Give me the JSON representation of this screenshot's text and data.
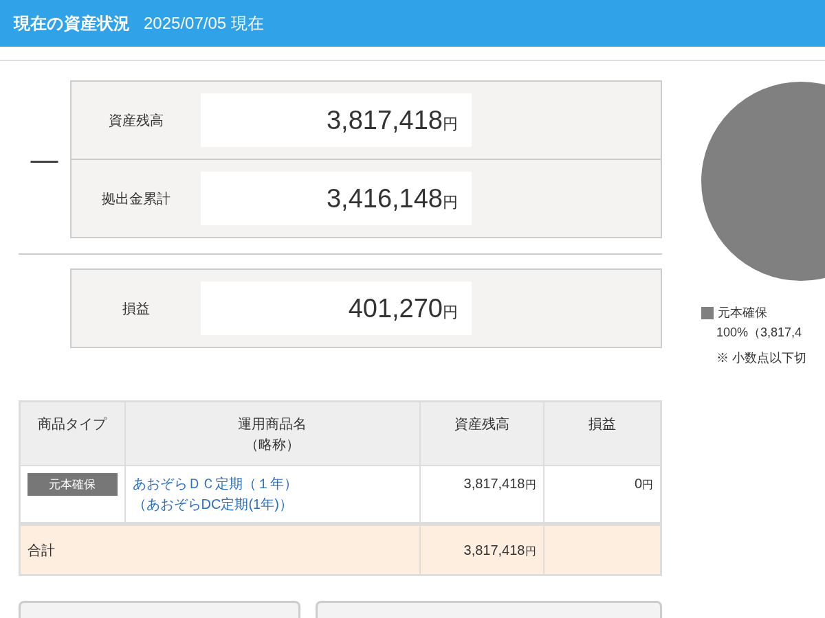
{
  "header": {
    "title": "現在の資産状況",
    "date": "2025/07/05 現在"
  },
  "summary": {
    "operator": "—",
    "rows": [
      {
        "label": "資産残高",
        "value": "3,817,418",
        "unit": "円"
      },
      {
        "label": "拠出金累計",
        "value": "3,416,148",
        "unit": "円"
      }
    ],
    "result": {
      "label": "損益",
      "value": "401,270",
      "unit": "円"
    }
  },
  "chart": {
    "legend": [
      {
        "label": "元本確保",
        "color": "#808080",
        "detail": "100%（3,817,4"
      }
    ],
    "note": "※ 小数点以下切"
  },
  "table": {
    "columns": [
      {
        "label": "商品タイプ"
      },
      {
        "label": "運用商品名",
        "sub": "（略称）"
      },
      {
        "label": "資産残高"
      },
      {
        "label": "損益"
      }
    ],
    "rows": [
      {
        "type": "元本確保",
        "name": "あおぞらＤＣ定期（１年）",
        "short": "（あおぞらDC定期(1年)）",
        "balance": "3,817,418",
        "balance_unit": "円",
        "pl": "0",
        "pl_unit": "円"
      }
    ],
    "total": {
      "label": "合計",
      "balance": "3,817,418",
      "unit": "円"
    }
  },
  "buttons": [
    {
      "kind": "button"
    },
    {
      "kind": "button"
    }
  ]
}
